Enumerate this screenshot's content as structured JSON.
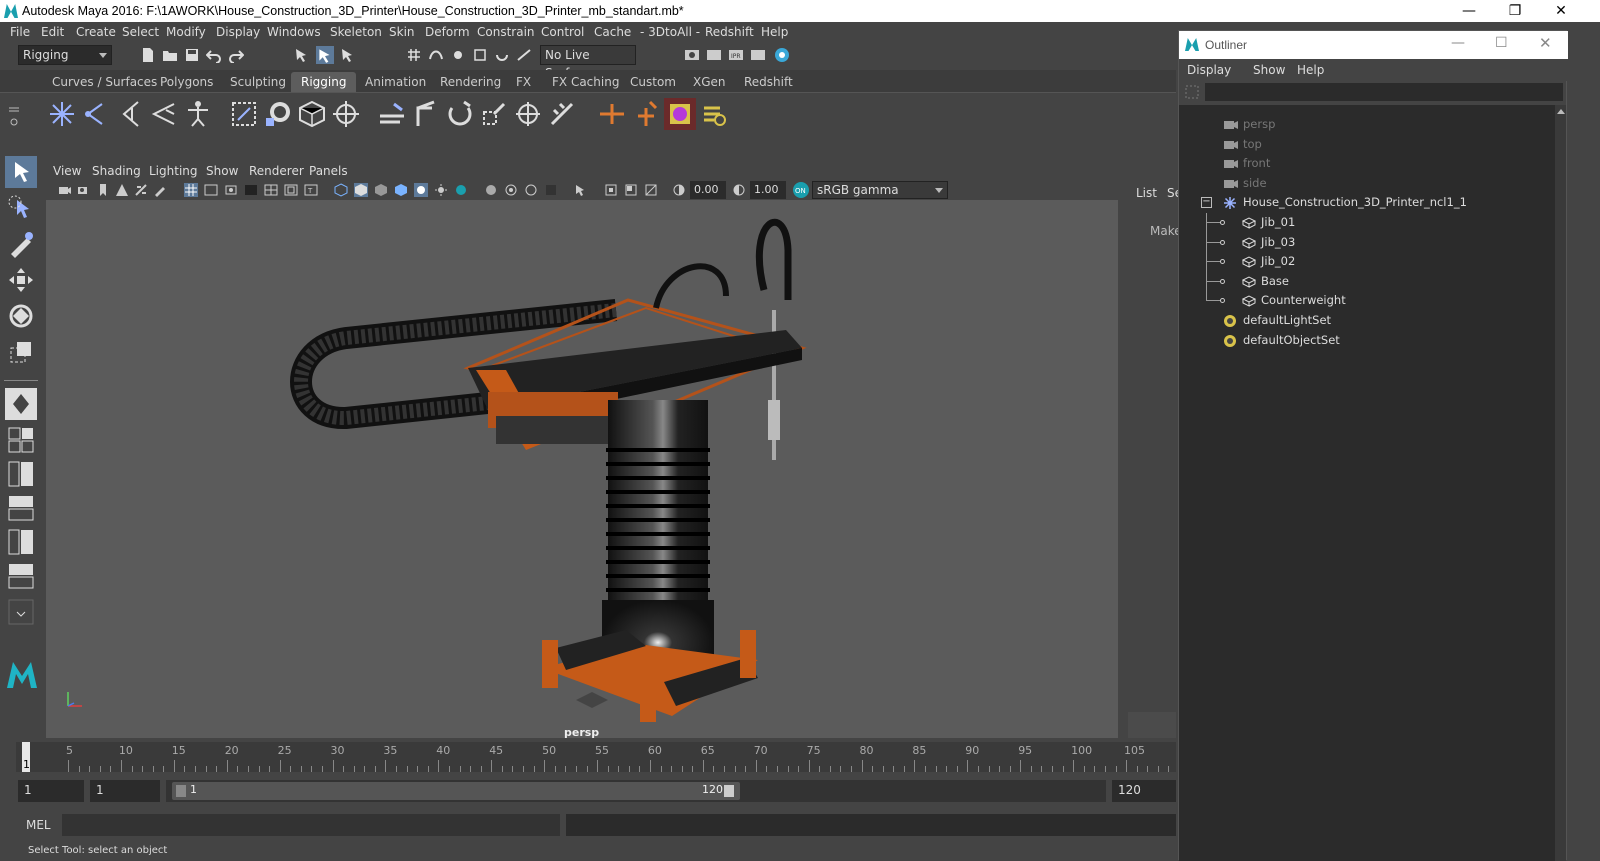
{
  "window": {
    "title": "Autodesk Maya 2016: F:\\1AWORK\\House_Construction_3D_Printer\\House_Construction_3D_Printer_mb_standart.mb*",
    "minimize": "—",
    "restore": "❐",
    "close": "✕"
  },
  "menubar": [
    "File",
    "Edit",
    "Create",
    "Select",
    "Modify",
    "Display",
    "Windows",
    "Skeleton",
    "Skin",
    "Deform",
    "Constrain",
    "Control",
    "Cache",
    "- 3DtoAll -",
    "Redshift",
    "Help"
  ],
  "statusline": {
    "menuset": "Rigging",
    "live_surface": "No Live Surface"
  },
  "shelf_tabs": [
    "Curves / Surfaces",
    "Polygons",
    "Sculpting",
    "Rigging",
    "Animation",
    "Rendering",
    "FX",
    "FX Caching",
    "Custom",
    "XGen",
    "Redshift"
  ],
  "active_shelf": "Rigging",
  "panel_menu": [
    "View",
    "Shading",
    "Lighting",
    "Show",
    "Renderer",
    "Panels"
  ],
  "panel_toolbar": {
    "exposure": "0.00",
    "gamma": "1.00",
    "color_space": "sRGB gamma"
  },
  "viewport": {
    "camera_label": "persp"
  },
  "right_strip": {
    "tab_list": "List",
    "tab_se": "Se",
    "make": "Make"
  },
  "timeline": {
    "ticks": [
      "5",
      "10",
      "15",
      "20",
      "25",
      "30",
      "35",
      "40",
      "45",
      "50",
      "55",
      "60",
      "65",
      "70",
      "75",
      "80",
      "85",
      "90",
      "95",
      "100",
      "105"
    ],
    "current_frame_marker": "1"
  },
  "range": {
    "start": "1",
    "playback_start": "1",
    "slider_start": "1",
    "slider_end": "120",
    "end": "120"
  },
  "mel": {
    "label": "MEL"
  },
  "helpline": "Select Tool: select an object",
  "outliner": {
    "title": "Outliner",
    "menu": [
      "Display",
      "Show",
      "Help"
    ],
    "rows": [
      {
        "label": "persp",
        "dim": true,
        "icon": "camera-icon"
      },
      {
        "label": "top",
        "dim": true,
        "icon": "camera-icon"
      },
      {
        "label": "front",
        "dim": true,
        "icon": "camera-icon"
      },
      {
        "label": "side",
        "dim": true,
        "icon": "camera-icon"
      },
      {
        "label": "House_Construction_3D_Printer_ncl1_1",
        "dim": false,
        "icon": "joint-icon"
      },
      {
        "label": "Jib_01",
        "dim": false,
        "icon": "mesh-icon"
      },
      {
        "label": "Jib_03",
        "dim": false,
        "icon": "mesh-icon"
      },
      {
        "label": "Jib_02",
        "dim": false,
        "icon": "mesh-icon"
      },
      {
        "label": "Base",
        "dim": false,
        "icon": "mesh-icon"
      },
      {
        "label": "Counterweight",
        "dim": false,
        "icon": "mesh-icon"
      },
      {
        "label": "defaultLightSet",
        "dim": false,
        "icon": "set-icon"
      },
      {
        "label": "defaultObjectSet",
        "dim": false,
        "icon": "set-icon"
      }
    ]
  }
}
